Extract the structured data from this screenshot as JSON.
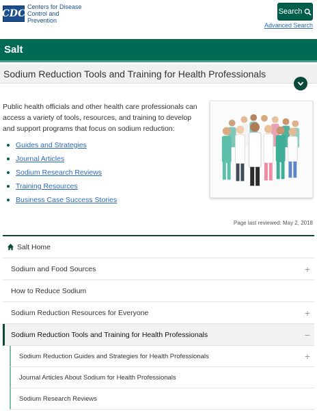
{
  "header": {
    "logo_mark": "CDC",
    "logo_text": "Centers for Disease Control and Prevention",
    "search_label": "Search",
    "advanced_search": "Advanced Search"
  },
  "section": {
    "title": "Salt"
  },
  "page": {
    "title": "Sodium Reduction Tools and Training for Health Professionals",
    "intro": "Public health officials and other health care professionals can access a variety of tools, resources, and training to develop and support programs that focus on sodium reduction:",
    "links": [
      "Guides and Strategies",
      "Journal Articles",
      "Sodium Research Reviews",
      "Training Resources",
      "Business Case Success Stories"
    ],
    "last_reviewed": "Page last reviewed: May 2, 2018"
  },
  "nav": {
    "home": "Salt Home",
    "items": [
      "Sodium and Food Sources",
      "How to Reduce Sodium",
      "Sodium Reduction Resources for Everyone",
      "Sodium Reduction Tools and Training for Health Professionals"
    ],
    "sub_items": [
      "Sodium Reduction Guides and Strategies for Health Professionals",
      "Journal Articles About Sodium for Health Professionals",
      "Sodium Research Reviews"
    ],
    "expand_symbol": "+",
    "collapse_symbol": "−"
  },
  "colors": {
    "brand_green": "#006b55",
    "dark_green": "#0b4a3b",
    "link_blue": "#2a6ab8",
    "cdc_blue": "#1a4f8b"
  }
}
